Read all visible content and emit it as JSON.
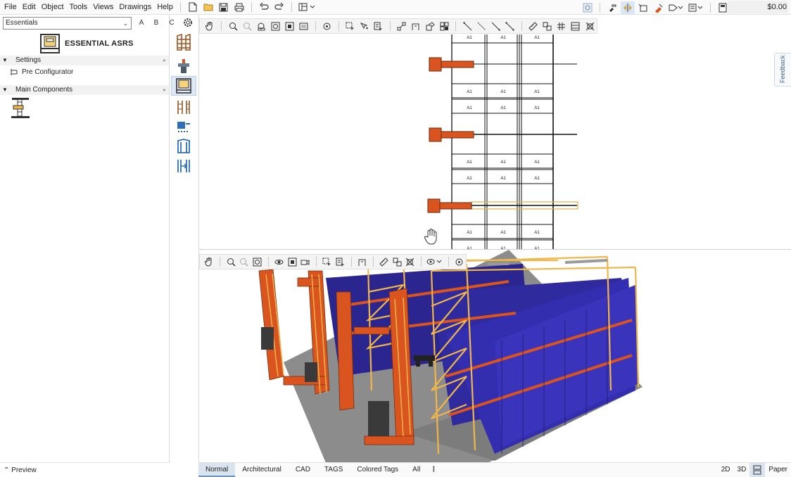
{
  "menubar": {
    "items": [
      "File",
      "Edit",
      "Object",
      "Tools",
      "Views",
      "Drawings",
      "Help"
    ],
    "price": "$0.00"
  },
  "left_panel": {
    "catalog_select": "Essentials",
    "abc": [
      "A",
      "B",
      "C"
    ],
    "brand_title": "ESSENTIAL ASRS",
    "settings_header": "Settings",
    "pre_configurator": "Pre Configurator",
    "main_components_header": "Main Components",
    "preview_label": "Preview"
  },
  "view2d": {
    "cell_label": "A1",
    "feedback_label": "Feedback"
  },
  "bottombar": {
    "tabs": [
      "Normal",
      "Architectural",
      "CAD",
      "TAGS",
      "Colored Tags",
      "All"
    ],
    "active_tab": "Normal",
    "right": [
      "2D",
      "3D",
      "Paper"
    ]
  },
  "colors": {
    "accent_orange": "#d9541e",
    "container_blue": "#2f2a9e",
    "rack_yellow": "#f0b64a",
    "selection_blue": "#d8e6f5"
  }
}
